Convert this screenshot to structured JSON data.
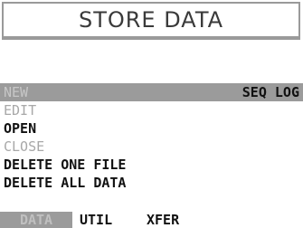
{
  "header": {
    "title": "STORE DATA"
  },
  "menu": {
    "items": [
      {
        "label": "NEW",
        "state": "selected",
        "right_label": "SEQ LOG"
      },
      {
        "label": "EDIT",
        "state": "disabled"
      },
      {
        "label": "OPEN",
        "state": "enabled"
      },
      {
        "label": "CLOSE",
        "state": "disabled"
      },
      {
        "label": "DELETE ONE FILE",
        "state": "enabled"
      },
      {
        "label": "DELETE ALL DATA",
        "state": "enabled"
      }
    ]
  },
  "tabs": [
    {
      "label": "DATA",
      "active": true
    },
    {
      "label": "UTIL",
      "active": false
    },
    {
      "label": "XFER",
      "active": false
    }
  ],
  "colors": {
    "highlight_bar": "#9b9b9b",
    "disabled_text": "#a8a8a8",
    "frame": "#9a9a9a"
  }
}
